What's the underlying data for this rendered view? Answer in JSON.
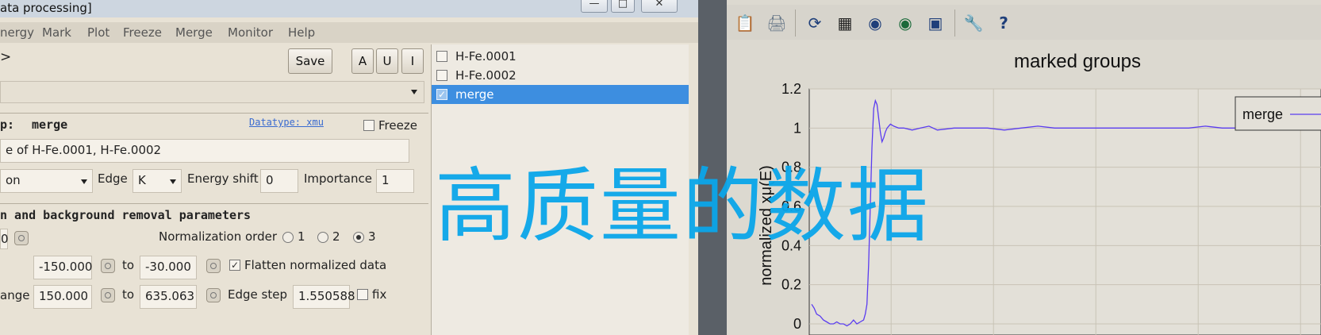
{
  "window": {
    "title": "ata processing]"
  },
  "menu": [
    "nergy",
    "Mark",
    "Plot",
    "Freeze",
    "Merge",
    "Monitor",
    "Help"
  ],
  "toolbar_left": {
    "back_glyph": ">",
    "save_label": "Save",
    "a_label": "A",
    "u_label": "U",
    "i_label": "I"
  },
  "group": {
    "label": "p:",
    "name": "merge",
    "datatype": "Datatype: xmu",
    "freeze_label": "Freeze",
    "description": "e of  H-Fe.0001, H-Fe.0002",
    "element_partial": "on",
    "edge_label": "Edge",
    "edge_value": "K",
    "energy_shift_label": "Energy shift",
    "energy_shift_value": "0",
    "importance_label": "Importance",
    "importance_value": "1"
  },
  "section": {
    "title": "n and background removal parameters"
  },
  "norm": {
    "e0_partial": "0",
    "order_label": "Normalization order",
    "orders": [
      "1",
      "2",
      "3"
    ],
    "selected_order": "3",
    "pre_edge_from": "-150.000",
    "to_label": "to",
    "pre_edge_to": "-30.000",
    "flatten_label": "Flatten normalized data",
    "range_label": "ange",
    "norm_from": "150.000",
    "norm_to": "635.063",
    "edge_step_label": "Edge step",
    "edge_step_value": "1.550588",
    "fix_label": "fix"
  },
  "group_list": [
    {
      "name": "H-Fe.0001",
      "checked": false,
      "selected": false
    },
    {
      "name": "H-Fe.0002",
      "checked": false,
      "selected": false
    },
    {
      "name": "merge",
      "checked": true,
      "selected": true
    }
  ],
  "plot_toolbar": [
    "clipboard-icon",
    "export-icon",
    "refresh-icon",
    "grid-icon",
    "zoom-out-icon",
    "zoom-in-icon",
    "zoom-fit-icon",
    "wrench-icon",
    "help-icon"
  ],
  "watermark": "高质量的数据",
  "chart_data": {
    "type": "line",
    "title": "marked groups",
    "ylabel": "normalized xμ(E)",
    "xlabel": "",
    "ylim": [
      0,
      1.2
    ],
    "yticks": [
      "0",
      "0.2",
      "0.4",
      "0.6",
      "0.8",
      "1",
      "1.2"
    ],
    "grid": true,
    "legend": "top-right",
    "series": [
      {
        "name": "merge",
        "color": "#5a3cf0",
        "x": [
          0,
          3,
          6,
          10,
          14,
          18,
          22,
          26,
          30,
          34,
          38,
          42,
          46,
          50,
          54,
          58,
          62,
          64,
          66,
          68,
          70,
          72,
          74,
          76,
          78,
          80,
          82,
          84,
          86,
          88,
          90,
          94,
          98,
          104,
          110,
          120,
          130,
          140,
          150,
          170,
          190,
          210,
          230,
          250,
          270,
          290,
          310,
          330,
          350,
          370,
          390,
          410,
          430,
          450,
          470,
          490,
          510,
          530,
          550,
          570,
          590,
          605
        ],
        "y": [
          0.1,
          0.08,
          0.05,
          0.04,
          0.02,
          0.01,
          0.0,
          0.0,
          0.01,
          0.0,
          0.0,
          -0.01,
          0.0,
          0.02,
          0.0,
          0.01,
          0.02,
          0.05,
          0.1,
          0.3,
          0.6,
          0.9,
          1.1,
          1.14,
          1.12,
          1.05,
          0.98,
          0.93,
          0.95,
          0.98,
          1.0,
          1.02,
          1.01,
          1.0,
          1.0,
          0.99,
          1.0,
          1.01,
          0.99,
          1.0,
          1.0,
          1.0,
          0.99,
          1.0,
          1.01,
          1.0,
          1.0,
          1.0,
          1.0,
          1.0,
          1.0,
          1.0,
          1.0,
          1.0,
          1.01,
          1.0,
          1.0,
          1.0,
          1.0,
          1.0,
          1.0,
          1.0
        ]
      }
    ]
  }
}
